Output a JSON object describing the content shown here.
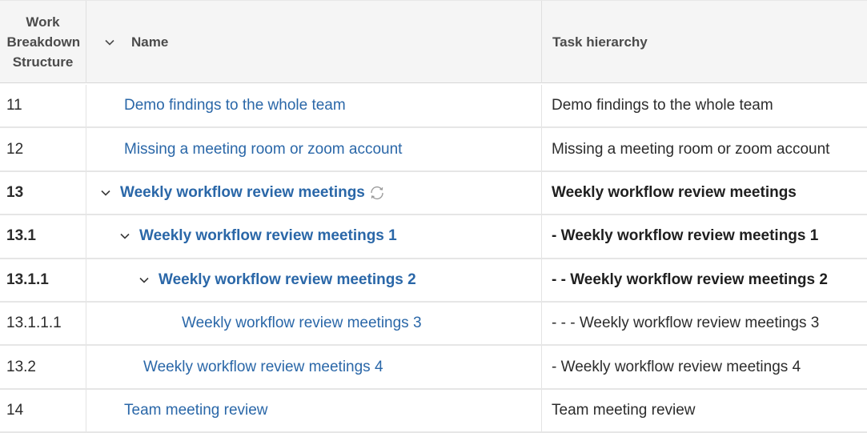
{
  "header": {
    "wbs_label": "Work Breakdown Structure",
    "name_label": "Name",
    "hierarchy_label": "Task hierarchy"
  },
  "rows": [
    {
      "wbs": "11",
      "name": "Demo findings to the whole team",
      "hierarchy": "Demo findings to the whole team",
      "bold": false,
      "indent": 0,
      "expandable": false,
      "recurring": false
    },
    {
      "wbs": "12",
      "name": "Missing a meeting room or zoom account",
      "hierarchy": "Missing a meeting room or zoom account",
      "bold": false,
      "indent": 0,
      "expandable": false,
      "recurring": false
    },
    {
      "wbs": "13",
      "name": "Weekly workflow review meetings",
      "hierarchy": "Weekly workflow review meetings",
      "bold": true,
      "indent": 0,
      "expandable": true,
      "recurring": true
    },
    {
      "wbs": "13.1",
      "name": "Weekly workflow review meetings 1",
      "hierarchy": "- Weekly workflow review meetings 1",
      "bold": true,
      "indent": 1,
      "expandable": true,
      "recurring": false
    },
    {
      "wbs": "13.1.1",
      "name": "Weekly workflow review meetings 2",
      "hierarchy": "- - Weekly workflow review meetings 2",
      "bold": true,
      "indent": 2,
      "expandable": true,
      "recurring": false
    },
    {
      "wbs": "13.1.1.1",
      "name": "Weekly workflow review meetings 3",
      "hierarchy": "- - - Weekly workflow review meetings 3",
      "bold": false,
      "indent": 3,
      "expandable": false,
      "recurring": false
    },
    {
      "wbs": "13.2",
      "name": "Weekly workflow review meetings 4",
      "hierarchy": "- Weekly workflow review meetings 4",
      "bold": false,
      "indent": 1,
      "expandable": false,
      "recurring": false
    },
    {
      "wbs": "14",
      "name": "Team meeting review",
      "hierarchy": "Team meeting review",
      "bold": false,
      "indent": 0,
      "expandable": false,
      "recurring": false
    }
  ],
  "colors": {
    "link": "#2a67a8",
    "text": "#2c2c2c",
    "header_bg": "#f5f5f5"
  },
  "icons": {
    "expand": "chevron-down-icon",
    "recurring": "recurring-icon",
    "sort": "chevron-down-icon"
  }
}
